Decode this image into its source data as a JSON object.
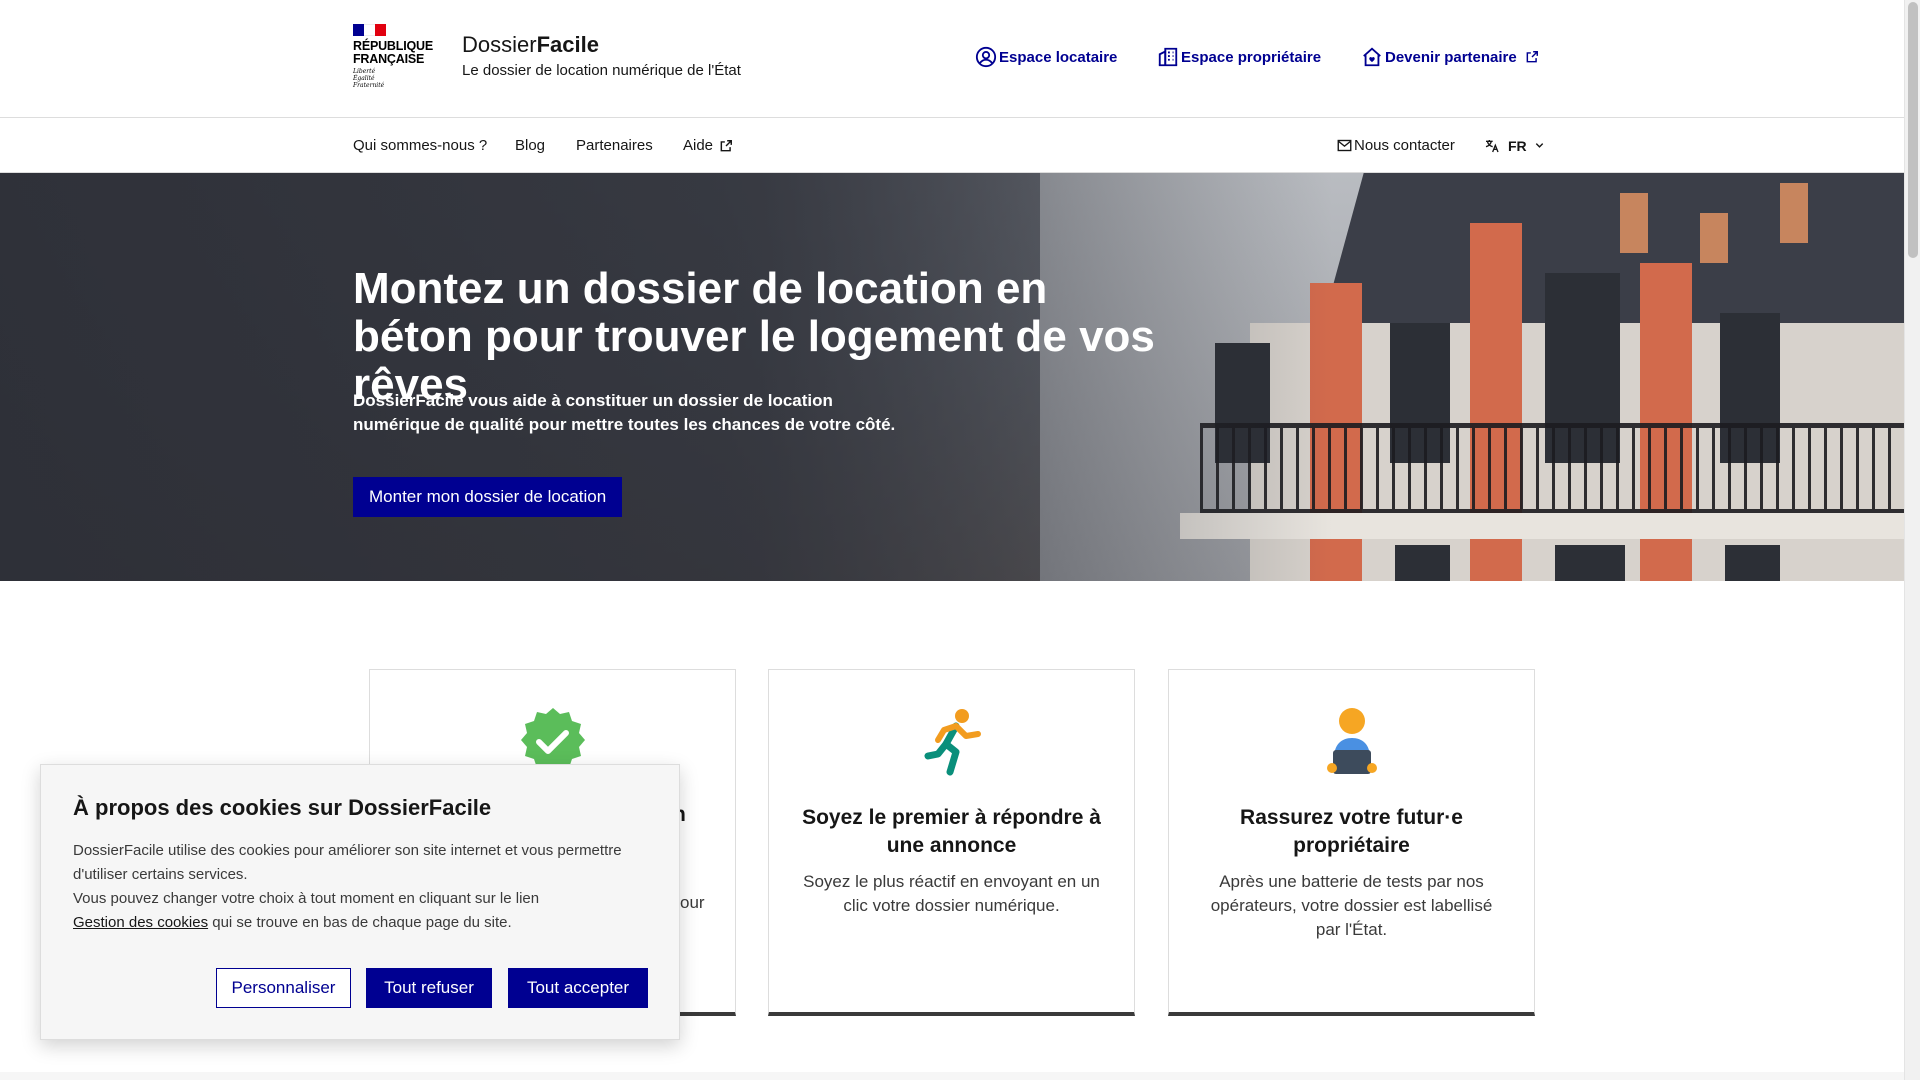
{
  "header": {
    "republic_lines": [
      "RÉPUBLIQUE",
      "FRANÇAISE"
    ],
    "motto_lines": [
      "Liberté",
      "Égalité",
      "Fraternité"
    ],
    "brand_name_prefix": "Dossier",
    "brand_name_suffix": "Facile",
    "tagline": "Le dossier de location numérique de l'État",
    "tools": [
      {
        "label": "Espace locataire",
        "icon": "user-circle-icon"
      },
      {
        "label": "Espace propriétaire",
        "icon": "building-icon"
      },
      {
        "label": "Devenir partenaire",
        "icon": "home-heart-icon",
        "external_icon": "external-link-icon"
      }
    ]
  },
  "nav": {
    "items": [
      "Qui sommes-nous ?",
      "Blog",
      "Partenaires",
      "Aide"
    ],
    "contact": "Nous contacter",
    "language": "FR"
  },
  "hero": {
    "title": "Montez un dossier de location en béton pour trouver le logement de vos rêves",
    "subtitle": "DossierFacile vous aide à constituer un dossier de location numérique de qualité pour mettre toutes les chances de votre côté.",
    "cta": "Monter mon dossier de location"
  },
  "cards": [
    {
      "icon": "verified-badge-icon",
      "title": "",
      "text": ""
    },
    {
      "icon": "running-person-icon",
      "title": "Soyez le premier à répondre à une annonce",
      "text": "Soyez le plus réactif en envoyant en un clic votre dossier numérique."
    },
    {
      "icon": "person-laptop-icon",
      "title": "Rassurez votre futur·e propriétaire",
      "text": "Après une batterie de tests par nos opérateurs, votre dossier est labellisé par l'État."
    }
  ],
  "cookie_banner": {
    "title": "À propos des cookies sur DossierFacile",
    "text_1": "DossierFacile utilise des cookies pour améliorer son site internet et vous permettre d'utiliser certains services.",
    "text_2": "Vous pouvez changer votre choix à tout moment en cliquant sur le lien",
    "link": "Gestion des cookies",
    "text_3": " qui se trouve en bas de chaque page du site.",
    "partial_card_title": "n",
    "partial_card_text": "our",
    "buttons": {
      "customize": "Personnaliser",
      "refuse": "Tout refuser",
      "accept": "Tout accepter"
    }
  },
  "colors": {
    "primary": "#000091",
    "flag_blue": "#000091",
    "flag_red": "#e1000f",
    "badge_green": "#5bbd5a",
    "runner_orange": "#f29c1f",
    "runner_teal": "#0a8f7b"
  }
}
